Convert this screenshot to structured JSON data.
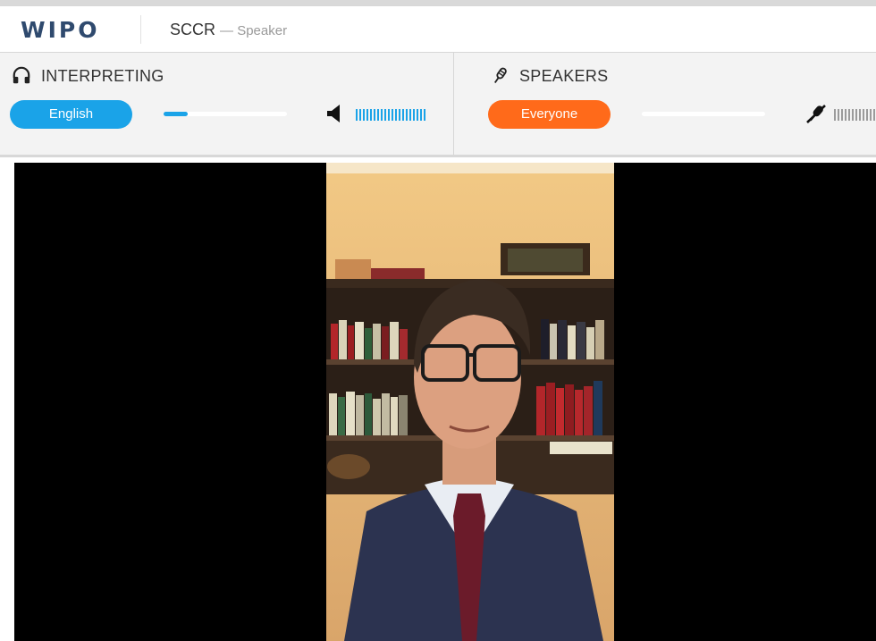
{
  "header": {
    "logo": "WIPO",
    "title": "SCCR",
    "subtitle": "— Speaker"
  },
  "interpreting": {
    "label": "INTERPRETING",
    "language": "English",
    "volume_level": 0.2,
    "icon": "headphones-icon",
    "speaker_icon": "speaker-icon",
    "accent": "#1aa3e8"
  },
  "speakers": {
    "label": "SPEAKERS",
    "audience": "Everyone",
    "volume_level": 0.0,
    "icon": "microphone-icon",
    "muted_icon": "microphone-off-icon",
    "accent": "#ff6a1a"
  },
  "video": {
    "description_icon": "video-feed"
  }
}
